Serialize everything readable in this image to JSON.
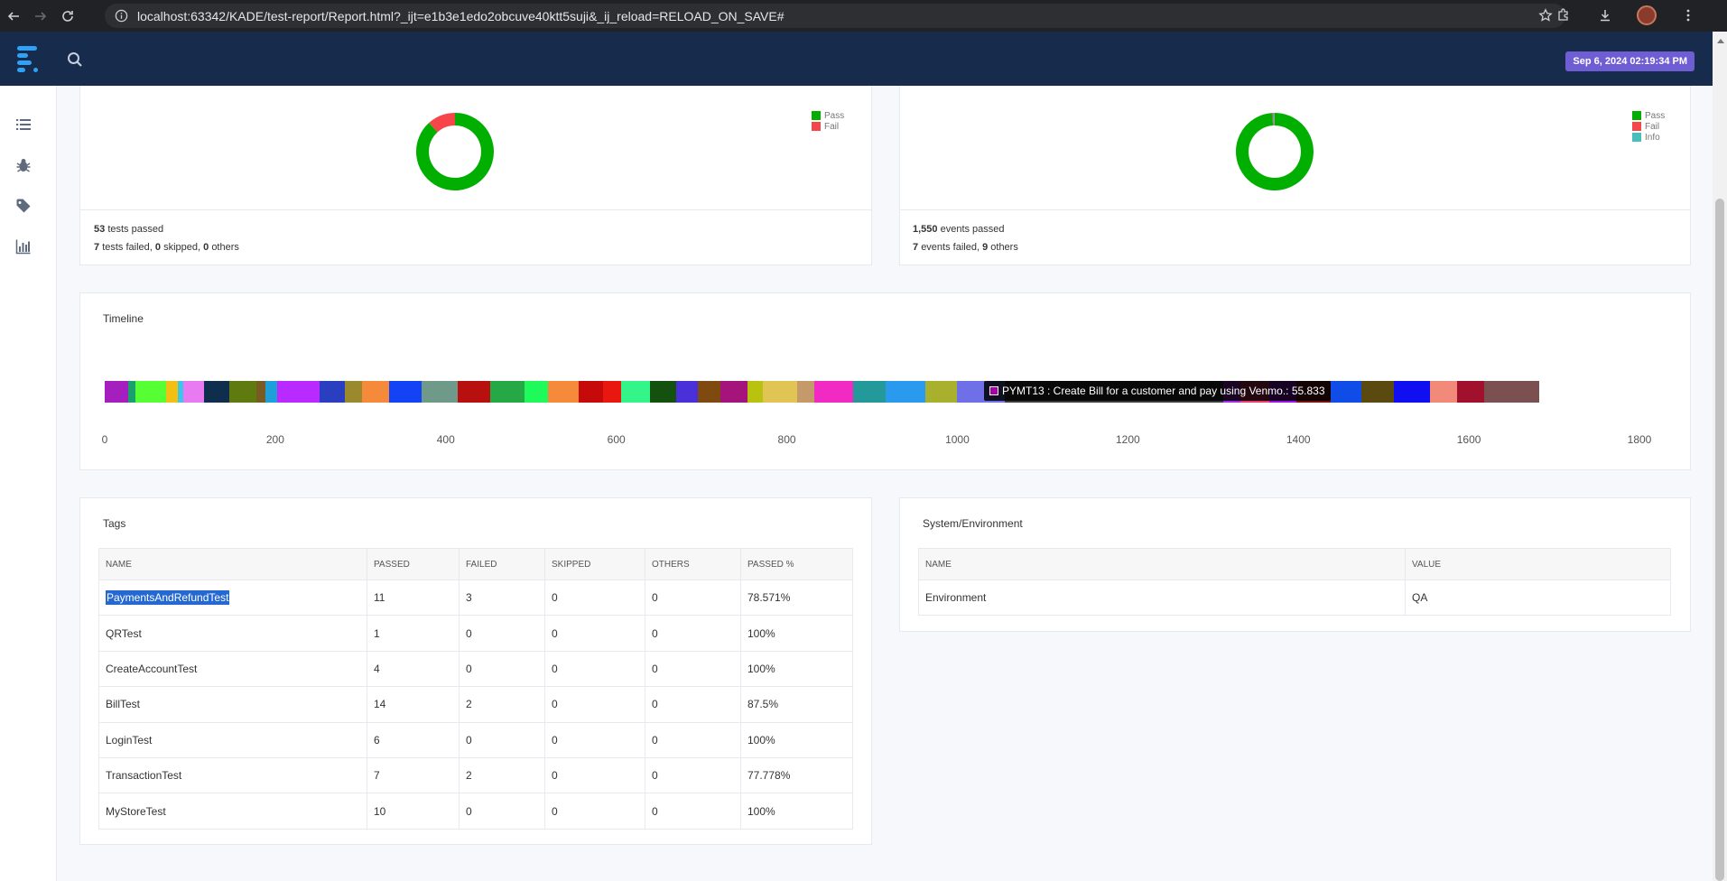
{
  "browser": {
    "url": "localhost:63342/KADE/test-report/Report.html?_ijt=e1b3e1edo2obcuve40ktt5suji&_ij_reload=RELOAD_ON_SAVE#"
  },
  "header": {
    "timestamp": "Sep 6, 2024 02:19:34 PM"
  },
  "tests_card": {
    "legend": [
      "Pass",
      "Fail"
    ],
    "passed_count": "53",
    "passed_label": "tests passed",
    "failed_count": "7",
    "failed_label": "tests failed,",
    "skipped_count": "0",
    "skipped_label": "skipped,",
    "others_count": "0",
    "others_label": "others",
    "chart_data": {
      "type": "pie",
      "donut": true,
      "labels": [
        "Pass",
        "Fail"
      ],
      "values": [
        53,
        7
      ],
      "colors": [
        "#00af00",
        "#f7464a"
      ]
    }
  },
  "events_card": {
    "legend": [
      "Pass",
      "Fail",
      "Info"
    ],
    "passed_count": "1,550",
    "passed_label": "events passed",
    "failed_count": "7",
    "failed_label": "events failed,",
    "others_count": "9",
    "others_label": "others",
    "chart_data": {
      "type": "pie",
      "donut": true,
      "labels": [
        "Pass",
        "Fail",
        "Info"
      ],
      "values": [
        1550,
        7,
        9
      ],
      "colors": [
        "#00af00",
        "#f7464a",
        "#46bfbd"
      ]
    }
  },
  "timeline": {
    "title": "Timeline",
    "axis_ticks": [
      "0",
      "200",
      "400",
      "600",
      "800",
      "1000",
      "1200",
      "1400",
      "1600",
      "1800"
    ],
    "tooltip": "PYMT13 : Create Bill for a customer and pay using Venmo.: 55.833",
    "chart_data": {
      "type": "bar",
      "orientation": "horizontal-stacked",
      "xlim": [
        0,
        1800
      ],
      "segments": [
        {
          "d": 28,
          "c": "#a51fbf"
        },
        {
          "d": 8,
          "c": "#1aa06b"
        },
        {
          "d": 36,
          "c": "#55ff33"
        },
        {
          "d": 14,
          "c": "#f2c012"
        },
        {
          "d": 6,
          "c": "#3ec6e8"
        },
        {
          "d": 24,
          "c": "#e87bf2"
        },
        {
          "d": 30,
          "c": "#0f2d4c"
        },
        {
          "d": 32,
          "c": "#5f7a0f"
        },
        {
          "d": 10,
          "c": "#7a5a23"
        },
        {
          "d": 14,
          "c": "#1e9fd8"
        },
        {
          "d": 50,
          "c": "#b82aff"
        },
        {
          "d": 30,
          "c": "#2a3fbf"
        },
        {
          "d": 20,
          "c": "#9a8a2d"
        },
        {
          "d": 32,
          "c": "#f58a3b"
        },
        {
          "d": 38,
          "c": "#1442f5"
        },
        {
          "d": 42,
          "c": "#6f9a89"
        },
        {
          "d": 38,
          "c": "#b80f0f"
        },
        {
          "d": 40,
          "c": "#25a845"
        },
        {
          "d": 28,
          "c": "#1dfa5a"
        },
        {
          "d": 36,
          "c": "#f58a3b"
        },
        {
          "d": 28,
          "c": "#c60a0a"
        },
        {
          "d": 22,
          "c": "#e8170f"
        },
        {
          "d": 34,
          "c": "#33f58a"
        },
        {
          "d": 30,
          "c": "#14510f"
        },
        {
          "d": 26,
          "c": "#4a30d8"
        },
        {
          "d": 26,
          "c": "#7f4a0f"
        },
        {
          "d": 32,
          "c": "#a5147a"
        },
        {
          "d": 18,
          "c": "#b8c20f"
        },
        {
          "d": 40,
          "c": "#e0c454"
        },
        {
          "d": 20,
          "c": "#c59a6a"
        },
        {
          "d": 46,
          "c": "#f22ac4"
        },
        {
          "d": 38,
          "c": "#23999a"
        },
        {
          "d": 46,
          "c": "#2a9aee"
        },
        {
          "d": 38,
          "c": "#a8b02d"
        },
        {
          "d": 56,
          "c": "#6f6fe8"
        },
        {
          "d": 256,
          "c": "#3a3a3a"
        },
        {
          "d": 20,
          "c": "#a52ae8"
        },
        {
          "d": 34,
          "c": "#f23a6a"
        },
        {
          "d": 32,
          "c": "#a10fe8"
        },
        {
          "d": 40,
          "c": "#7a0f0f"
        },
        {
          "d": 36,
          "c": "#0f4ce8"
        },
        {
          "d": 38,
          "c": "#5a4a0f"
        },
        {
          "d": 42,
          "c": "#0f0ff2"
        },
        {
          "d": 32,
          "c": "#f28a7a"
        },
        {
          "d": 32,
          "c": "#a1102d"
        },
        {
          "d": 64,
          "c": "#7a5050"
        }
      ]
    }
  },
  "tags": {
    "title": "Tags",
    "columns": [
      "NAME",
      "PASSED",
      "FAILED",
      "SKIPPED",
      "OTHERS",
      "PASSED %"
    ],
    "rows": [
      [
        "PaymentsAndRefundTest",
        "11",
        "3",
        "0",
        "0",
        "78.571%"
      ],
      [
        "QRTest",
        "1",
        "0",
        "0",
        "0",
        "100%"
      ],
      [
        "CreateAccountTest",
        "4",
        "0",
        "0",
        "0",
        "100%"
      ],
      [
        "BillTest",
        "14",
        "2",
        "0",
        "0",
        "87.5%"
      ],
      [
        "LoginTest",
        "6",
        "0",
        "0",
        "0",
        "100%"
      ],
      [
        "TransactionTest",
        "7",
        "2",
        "0",
        "0",
        "77.778%"
      ],
      [
        "MyStoreTest",
        "10",
        "0",
        "0",
        "0",
        "100%"
      ]
    ]
  },
  "sysenv": {
    "title": "System/Environment",
    "columns": [
      "NAME",
      "VALUE"
    ],
    "rows": [
      [
        "Environment",
        "QA"
      ]
    ]
  }
}
